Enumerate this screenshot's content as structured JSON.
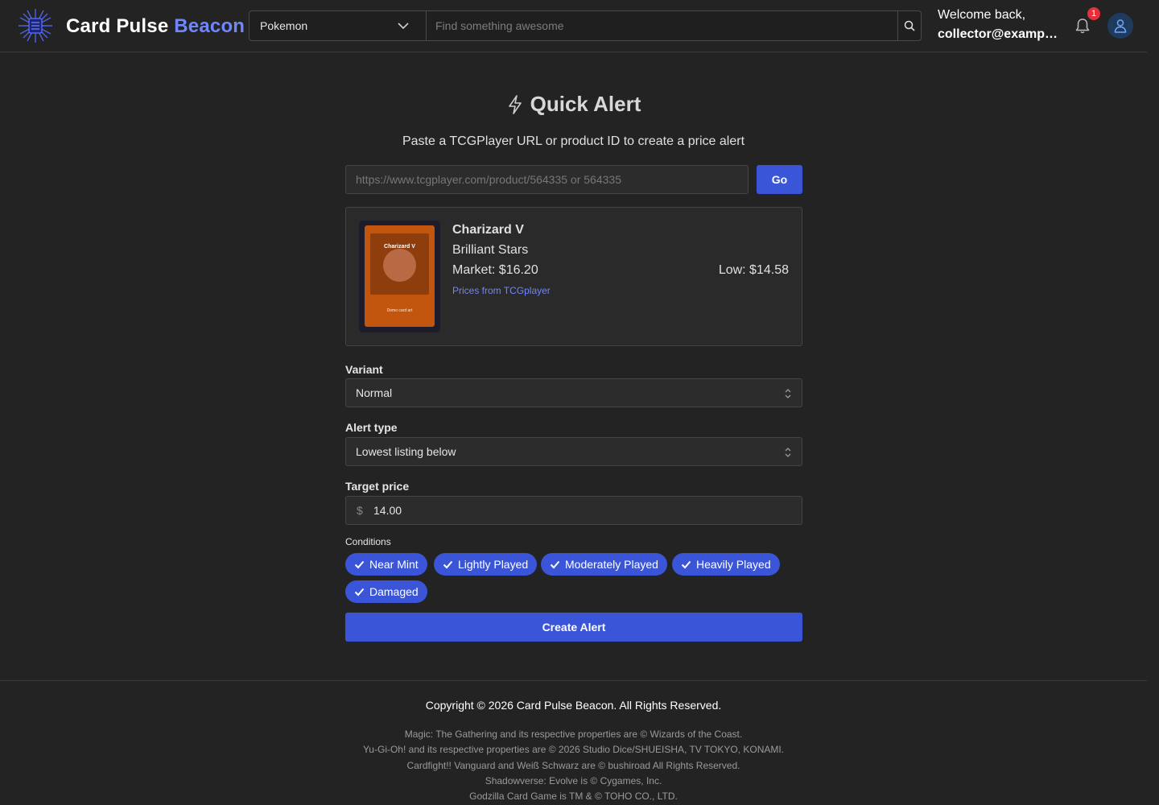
{
  "header": {
    "brand_primary": "Card Pulse",
    "brand_accent": "Beacon",
    "game_selected": "Pokemon",
    "search_placeholder": "Find something awesome",
    "welcome": "Welcome back,",
    "email": "collector@example.com",
    "notification_count": "1"
  },
  "main": {
    "title": "Quick Alert",
    "subtitle": "Paste a TCGPlayer URL or product ID to create a price alert",
    "url_placeholder": "https://www.tcgplayer.com/product/564335 or 564335",
    "go_label": "Go",
    "product": {
      "name": "Charizard V",
      "set": "Brilliant Stars",
      "market": "Market: $16.20",
      "low": "Low: $14.58",
      "source": "Prices from TCGplayer",
      "thumb_name": "Charizard V",
      "thumb_footer": "Demo card art"
    },
    "variant_label": "Variant",
    "variant_value": "Normal",
    "alert_type_label": "Alert type",
    "alert_type_value": "Lowest listing below",
    "target_price_label": "Target price",
    "currency_symbol": "$",
    "target_price_value": "14.00",
    "conditions_label": "Conditions",
    "conditions": [
      "Near Mint",
      "Lightly Played",
      "Moderately Played",
      "Heavily Played",
      "Damaged"
    ],
    "create_label": "Create Alert"
  },
  "footer": {
    "copyright": "Copyright © 2026 Card Pulse Beacon. All Rights Reserved.",
    "legal": [
      "Magic: The Gathering and its respective properties are © Wizards of the Coast.",
      "Yu-Gi-Oh! and its respective properties are © 2026 Studio Dice/SHUEISHA, TV TOKYO, KONAMI.",
      "Cardfight!! Vanguard and Weiß Schwarz are © bushiroad All Rights Reserved.",
      "Shadowverse: Evolve is © Cygames, Inc.",
      "Godzilla Card Game is TM & © TOHO CO., LTD."
    ]
  },
  "colors": {
    "background": "#232323",
    "accent": "#3b55d9",
    "brand_accent": "#6f86ff",
    "badge": "#e5303a"
  },
  "icons": {
    "logo": "starburst-logo-icon",
    "dropdown": "chevron-down-icon",
    "search": "search-icon",
    "notifications": "bell-icon",
    "account": "user-icon",
    "title": "lightning-bolt-icon",
    "select": "select-updown-icon",
    "chip": "check-icon"
  }
}
